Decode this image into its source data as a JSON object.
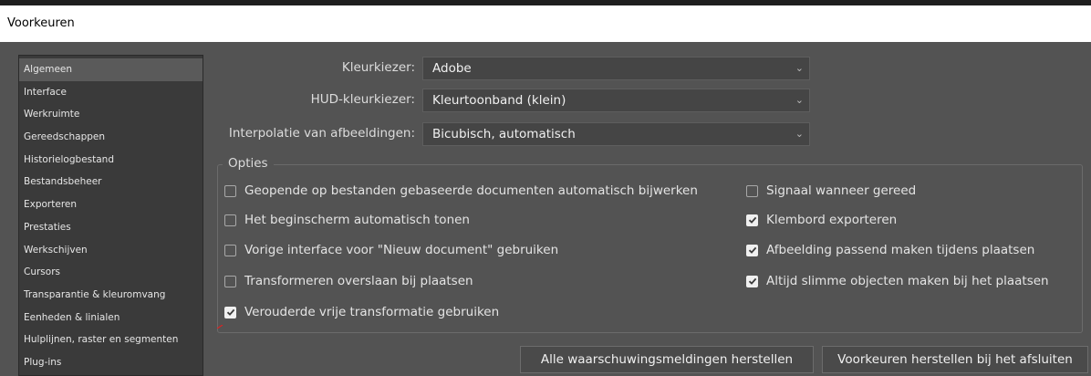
{
  "window": {
    "title": "Voorkeuren"
  },
  "sidebar": {
    "items": [
      {
        "label": "Algemeen",
        "active": true
      },
      {
        "label": "Interface"
      },
      {
        "label": "Werkruimte"
      },
      {
        "label": "Gereedschappen"
      },
      {
        "label": "Historielogbestand"
      },
      {
        "label": "Bestandsbeheer"
      },
      {
        "label": "Exporteren"
      },
      {
        "label": "Prestaties"
      },
      {
        "label": "Werkschijven"
      },
      {
        "label": "Cursors"
      },
      {
        "label": "Transparantie & kleuromvang"
      },
      {
        "label": "Eenheden & linialen"
      },
      {
        "label": "Hulplijnen, raster en segmenten"
      },
      {
        "label": "Plug-ins"
      }
    ]
  },
  "fields": {
    "color_picker": {
      "label": "Kleurkiezer:",
      "value": "Adobe"
    },
    "hud_color_picker": {
      "label": "HUD-kleurkiezer:",
      "value": "Kleurtoonband (klein)"
    },
    "interpolation": {
      "label": "Interpolatie van afbeeldingen:",
      "value": "Bicubisch, automatisch"
    }
  },
  "options": {
    "legend": "Opties",
    "left": [
      {
        "label": "Geopende op bestanden gebaseerde documenten automatisch bijwerken",
        "checked": false
      },
      {
        "label": "Het beginscherm automatisch tonen",
        "checked": false
      },
      {
        "label": "Vorige interface voor \"Nieuw document\" gebruiken",
        "checked": false
      },
      {
        "label": "Transformeren overslaan bij plaatsen",
        "checked": false
      },
      {
        "label": "Verouderde vrije transformatie gebruiken",
        "checked": true
      }
    ],
    "right": [
      {
        "label": "Signaal wanneer gereed",
        "checked": false
      },
      {
        "label": "Klembord exporteren",
        "checked": true
      },
      {
        "label": "Afbeelding passend maken tijdens plaatsen",
        "checked": true
      },
      {
        "label": "Altijd slimme objecten maken bij het plaatsen",
        "checked": true
      }
    ]
  },
  "buttons": {
    "reset_warnings": "Alle waarschuwingsmeldingen herstellen",
    "reset_prefs_on_quit": "Voorkeuren herstellen bij het afsluiten"
  },
  "colors": {
    "background": "#535353",
    "sidebar": "#3a3a3a",
    "selected": "#5a5a5a",
    "field": "#454545"
  }
}
